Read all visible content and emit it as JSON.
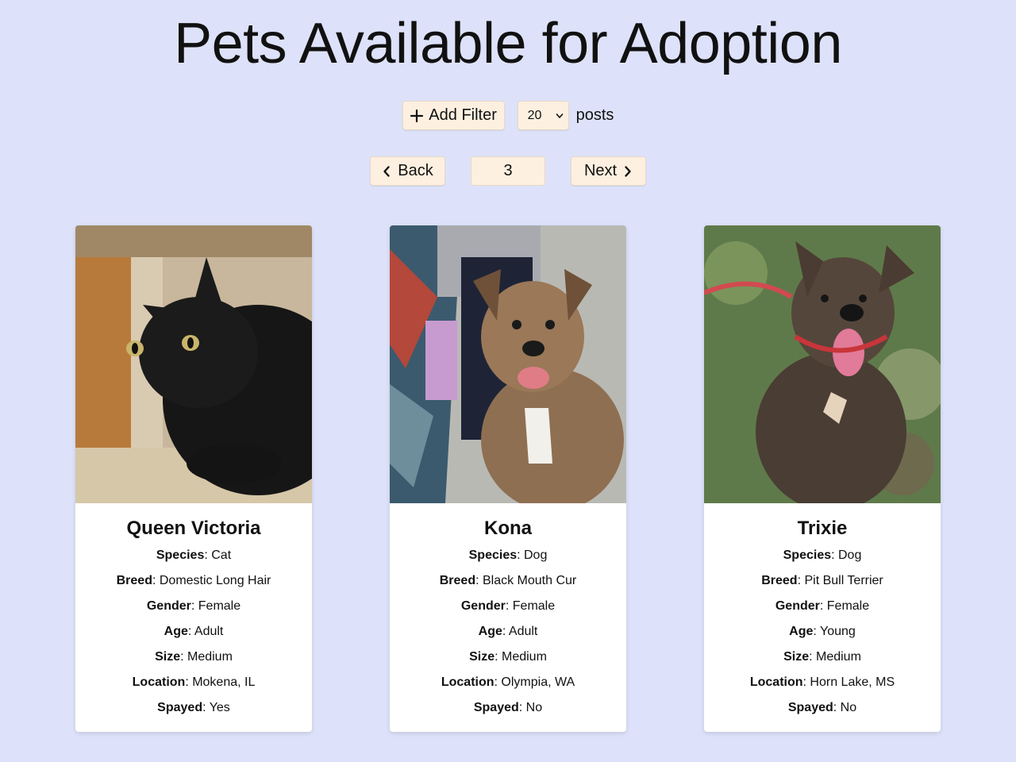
{
  "page": {
    "title": "Pets Available for Adoption"
  },
  "controls": {
    "add_filter_label": "Add Filter",
    "posts_per_page": "20",
    "posts_label": "posts"
  },
  "pager": {
    "back_label": "Back",
    "current_page": "3",
    "next_label": "Next"
  },
  "field_labels": {
    "species": "Species",
    "breed": "Breed",
    "gender": "Gender",
    "age": "Age",
    "size": "Size",
    "location": "Location",
    "spayed": "Spayed"
  },
  "pets": [
    {
      "name": "Queen Victoria",
      "species": "Cat",
      "breed": "Domestic Long Hair",
      "gender": "Female",
      "age": "Adult",
      "size": "Medium",
      "location": "Mokena, IL",
      "spayed": "Yes",
      "photo_icon": "black-cat-photo"
    },
    {
      "name": "Kona",
      "species": "Dog",
      "breed": "Black Mouth Cur",
      "gender": "Female",
      "age": "Adult",
      "size": "Medium",
      "location": "Olympia, WA",
      "spayed": "No",
      "photo_icon": "tan-dog-photo"
    },
    {
      "name": "Trixie",
      "species": "Dog",
      "breed": "Pit Bull Terrier",
      "gender": "Female",
      "age": "Young",
      "size": "Medium",
      "location": "Horn Lake, MS",
      "spayed": "No",
      "photo_icon": "brindle-dog-photo"
    }
  ],
  "colors": {
    "background": "#dde2fa",
    "button": "#fdf0e0",
    "card": "#ffffff"
  }
}
